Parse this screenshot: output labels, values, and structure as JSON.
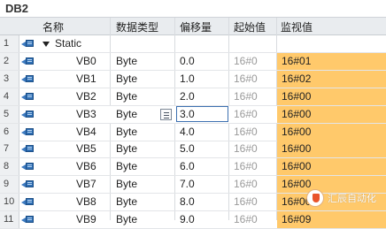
{
  "block_title": "DB2",
  "headers": {
    "name": "名称",
    "data_type": "数据类型",
    "offset": "偏移量",
    "start_value": "起始值",
    "monitor_value": "监视值"
  },
  "colors": {
    "monitor_bg": "#ffc96b",
    "header_bg": "#e9ecef",
    "icon_blue": "#2f6fb5"
  },
  "rows": [
    {
      "num": "1",
      "name": "Static",
      "type": "",
      "offset": "",
      "start": "",
      "watch": "",
      "icon": "db-element-icon",
      "expanded": true
    },
    {
      "num": "2",
      "name": "VB0",
      "type": "Byte",
      "offset": "0.0",
      "start": "16#0",
      "watch": "16#01",
      "icon": "db-element-icon"
    },
    {
      "num": "3",
      "name": "VB1",
      "type": "Byte",
      "offset": "1.0",
      "start": "16#0",
      "watch": "16#02",
      "icon": "db-element-icon"
    },
    {
      "num": "4",
      "name": "VB2",
      "type": "Byte",
      "offset": "2.0",
      "start": "16#0",
      "watch": "16#00",
      "icon": "db-element-icon"
    },
    {
      "num": "5",
      "name": "VB3",
      "type": "Byte",
      "offset": "3.0",
      "start": "16#0",
      "watch": "16#00",
      "icon": "db-element-icon",
      "selected": true
    },
    {
      "num": "6",
      "name": "VB4",
      "type": "Byte",
      "offset": "4.0",
      "start": "16#0",
      "watch": "16#00",
      "icon": "db-element-icon"
    },
    {
      "num": "7",
      "name": "VB5",
      "type": "Byte",
      "offset": "5.0",
      "start": "16#0",
      "watch": "16#00",
      "icon": "db-element-icon"
    },
    {
      "num": "8",
      "name": "VB6",
      "type": "Byte",
      "offset": "6.0",
      "start": "16#0",
      "watch": "16#00",
      "icon": "db-element-icon"
    },
    {
      "num": "9",
      "name": "VB7",
      "type": "Byte",
      "offset": "7.0",
      "start": "16#0",
      "watch": "16#00",
      "icon": "db-element-icon"
    },
    {
      "num": "10",
      "name": "VB8",
      "type": "Byte",
      "offset": "8.0",
      "start": "16#0",
      "watch": "16#00",
      "icon": "db-element-icon"
    },
    {
      "num": "11",
      "name": "VB9",
      "type": "Byte",
      "offset": "9.0",
      "start": "16#0",
      "watch": "16#09",
      "icon": "db-element-icon"
    }
  ],
  "watermark": {
    "text": "汇辰自动化",
    "icon": "wechat-logo-icon"
  }
}
